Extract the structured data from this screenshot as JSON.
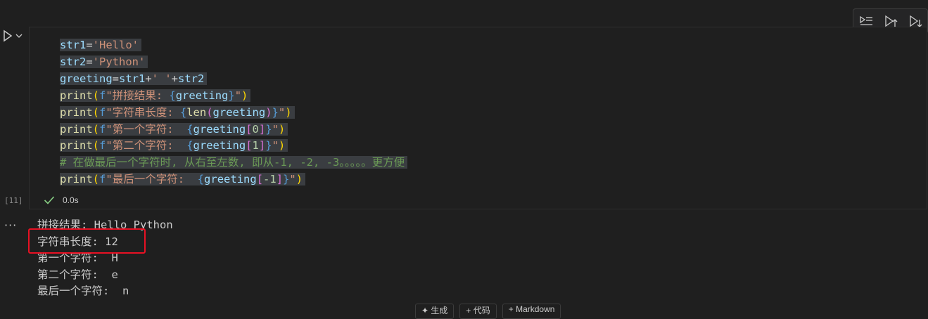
{
  "toolbar": {
    "icons": [
      "execute-above-icon",
      "run-above-icon",
      "run-below-icon"
    ]
  },
  "cell": {
    "execution_count": "[11]",
    "status_time": "0.0s",
    "code_lines": [
      "str1='Hello'",
      "str2='Python'",
      "greeting=str1+' '+str2",
      "print(f\"拼接结果: {greeting}\")",
      "print(f\"字符串长度: {len(greeting)}\")",
      "print(f\"第一个字符:  {greeting[0]}\")",
      "print(f\"第二个字符:  {greeting[1]}\")",
      "# 在做最后一个字符时, 从右至左数, 即从-1, -2, -3。。。。。更方便",
      "print(f\"最后一个字符:  {greeting[-1]}\")"
    ]
  },
  "output": {
    "toggle": "···",
    "lines": [
      "拼接结果: Hello Python",
      "字符串长度: 12",
      "第一个字符:  H",
      "第二个字符:  e",
      "最后一个字符:  n"
    ]
  },
  "bottom_buttons": [
    "✦ 生成",
    "+ 代码",
    "+ Markdown"
  ],
  "colors": {
    "background": "#1f1f1f",
    "highlight": "#e81123",
    "success": "#89d185"
  }
}
